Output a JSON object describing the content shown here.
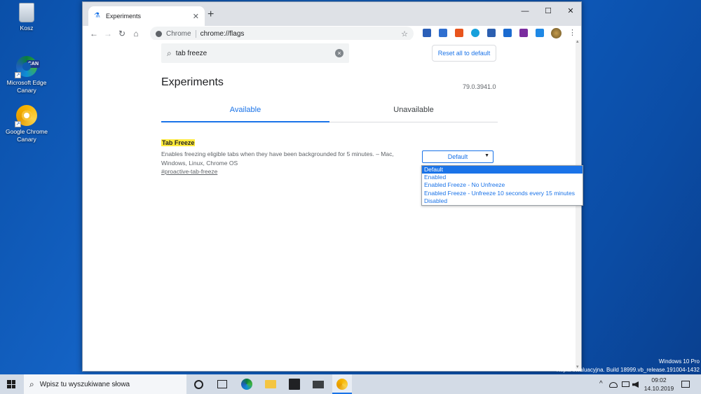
{
  "desktop": {
    "icons": [
      {
        "label": "Kosz",
        "icon": "recycle-bin-icon"
      },
      {
        "label": "Microsoft Edge Canary",
        "icon": "edge-canary-icon",
        "badge": "CAN"
      },
      {
        "label": "Google Chrome Canary",
        "icon": "chrome-canary-icon"
      }
    ],
    "watermark_line1": "Windows 10 Pro",
    "watermark_line2": "Kopia ewaluacyjna. Build 18999.vb_release.191004-1432"
  },
  "browser": {
    "tab_title": "Experiments",
    "tab_close": "✕",
    "new_tab": "+",
    "window_controls": {
      "minimize": "—",
      "maximize": "☐",
      "close": "✕"
    },
    "omnibox": {
      "site_label": "Chrome",
      "url": "chrome://flags"
    },
    "nav": {
      "back": "←",
      "forward": "→",
      "reload": "↻",
      "home": "⌂"
    },
    "star": "☆",
    "menu": "⋮"
  },
  "flags_page": {
    "search_value": "tab freeze",
    "reset_button": "Reset all to default",
    "title": "Experiments",
    "version": "79.0.3941.0",
    "tabs": [
      "Available",
      "Unavailable"
    ],
    "flag": {
      "name": "Tab Freeze",
      "description": "Enables freezing eligible tabs when they have been backgrounded for 5 minutes. – Mac, Windows, Linux, Chrome OS",
      "link": "#proactive-tab-freeze",
      "selected": "Default",
      "options": [
        "Default",
        "Enabled",
        "Enabled Freeze - No Unfreeze",
        "Enabled Freeze - Unfreeze 10 seconds every 15 minutes",
        "Disabled"
      ]
    }
  },
  "taskbar": {
    "search_placeholder": "Wpisz tu wyszukiwane słowa",
    "time": "09:02",
    "date": "14.10.2019",
    "tray_chevron": "^"
  },
  "colors": {
    "accent": "#1a73e8",
    "highlight": "#ffeb3b",
    "desktop": "#0f5ab5"
  }
}
